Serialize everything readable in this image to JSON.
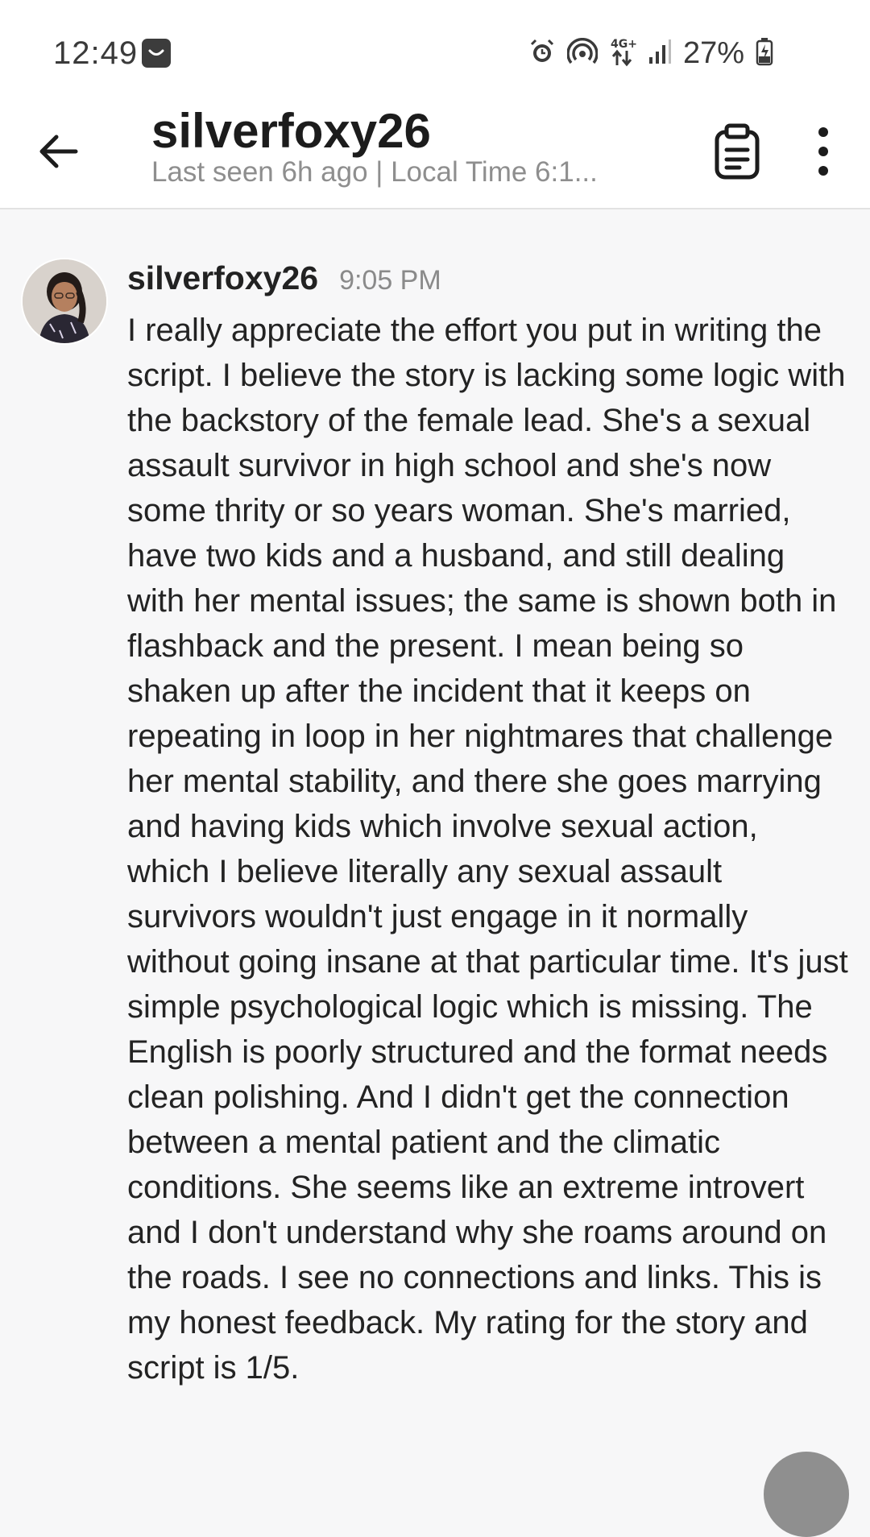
{
  "status_bar": {
    "time": "12:49",
    "battery": "27%",
    "network": "4G+",
    "icons": [
      "message-notification-icon",
      "alarm-icon",
      "hotspot-icon",
      "network-4g-icon",
      "signal-icon",
      "battery-charging-icon"
    ]
  },
  "header": {
    "title": "silverfoxy26",
    "subtitle": "Last seen 6h ago | Local Time 6:1..."
  },
  "message": {
    "sender": "silverfoxy26",
    "time": "9:05 PM",
    "text": "I really appreciate the effort you put in writing the script. I believe the story is lacking some logic with the backstory of the female lead. She's a sexual assault survivor in high school and she's now some thrity or so years woman. She's married, have two kids and a husband, and still dealing with her mental issues; the same is shown both in flashback and the present. I mean being so shaken up after the incident that it keeps on repeating in loop in her nightmares that challenge her mental stability, and there she goes marrying and having kids which involve sexual action, which I believe literally any sexual assault survivors wouldn't just engage in it normally without going insane at that particular time. It's just simple psychological logic which is missing. The English is poorly structured and the format needs clean polishing. And I didn't get the connection between a mental patient and the climatic conditions. She seems like an extreme introvert and I don't understand why she roams around on the roads. I see no connections and links. This is my honest feedback. My rating for the story and script is 1/5."
  },
  "colors": {
    "background": "#f7f7f8",
    "header_bg": "#ffffff",
    "muted_text": "#8e8e8e"
  }
}
